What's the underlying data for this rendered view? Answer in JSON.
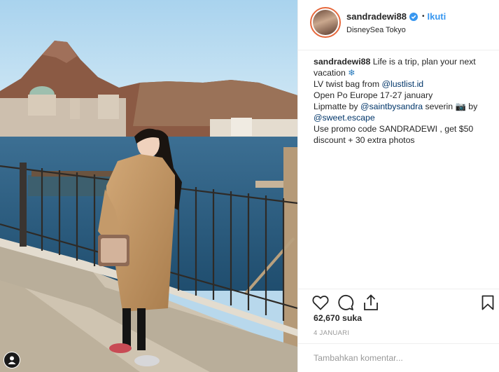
{
  "post": {
    "username": "sandradewi88",
    "follow_label": "Ikuti",
    "dot": "•",
    "location": "DisneySea Tokyo",
    "more_label": "•••"
  },
  "caption": {
    "username": "sandradewi88",
    "line1": " Life is a trip, plan your next",
    "line2_text": "vacation ",
    "line2_emoji": "❄",
    "line3_prefix": "LV twist bag from ",
    "line3_mention": "@lustlist.id",
    "line4": "Open Po Europe 17-27 january",
    "line5_prefix": "Lipmatte by ",
    "line5_mention": "@saintbysandra",
    "line5_suffix": " severin ",
    "line5_emoji": "📷",
    "line5_by": " by",
    "line6_mention": "@sweet.escape",
    "line7": "Use promo code SANDRADEWI , get $50",
    "line8": "discount + 30 extra photos"
  },
  "engagement": {
    "likes": "62,670 suka",
    "date": "4 JANUARI"
  },
  "comment": {
    "placeholder": "Tambahkan komentar..."
  },
  "icons": [
    "profile-icon",
    "verified-badge-icon",
    "heart-icon",
    "comment-icon",
    "share-icon",
    "bookmark-icon"
  ],
  "colors": {
    "link": "#3897f0",
    "mention": "#003569",
    "muted": "#999999",
    "border": "#efefef"
  }
}
